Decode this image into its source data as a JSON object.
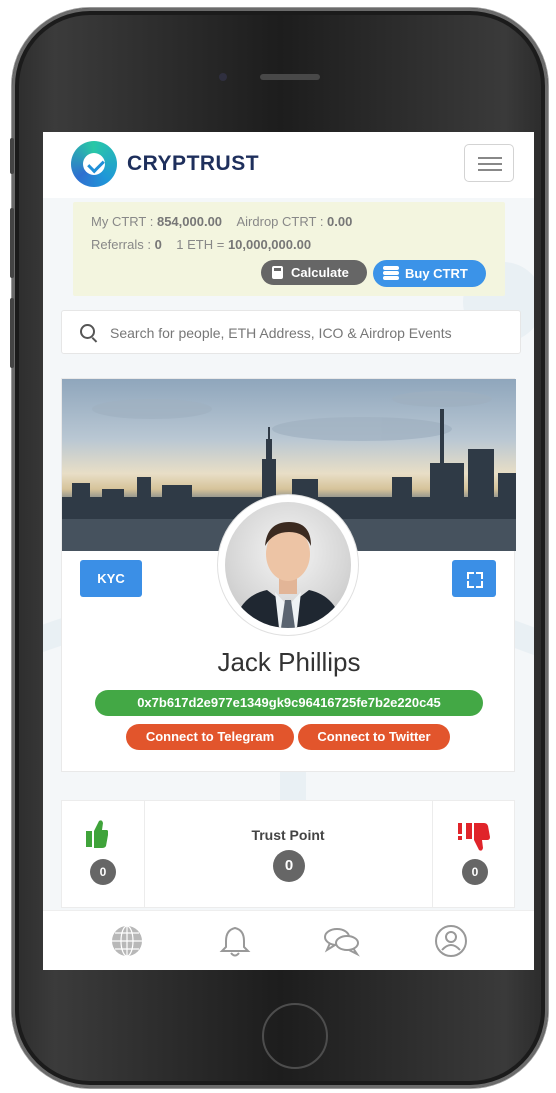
{
  "brand": {
    "name": "CRYPTRUST",
    "logo_icon": "cryptrust-logo-icon"
  },
  "header": {
    "menu_icon": "hamburger-menu-icon"
  },
  "stats": {
    "my_ctrt_label": "My CTRT : ",
    "my_ctrt_value": "854,000.00",
    "airdrop_label": "Airdrop CTRT : ",
    "airdrop_value": "0.00",
    "referrals_label": "Referrals : ",
    "referrals_value": "0",
    "eth_rate_label": "1 ETH = ",
    "eth_rate_value": "10,000,000.00",
    "calculate_label": "Calculate",
    "buy_label": "Buy CTRT"
  },
  "search": {
    "placeholder": "Search for people, ETH Address, ICO & Airdrop Events"
  },
  "profile": {
    "kyc_label": "KYC",
    "name": "Jack Phillips",
    "eth_address": "0x7b617d2e977e1349gk9c96416725fe7b2e220c45",
    "telegram_label": "Connect to Telegram",
    "twitter_label": "Connect to Twitter"
  },
  "trust": {
    "upvotes": "0",
    "title": "Trust Point",
    "score": "0",
    "downvotes": "0"
  },
  "nav": {
    "items": [
      {
        "icon": "globe-icon"
      },
      {
        "icon": "bell-icon"
      },
      {
        "icon": "chat-icon"
      },
      {
        "icon": "user-profile-icon"
      }
    ]
  },
  "colors": {
    "primary": "#3b8fe6",
    "success": "#43a845",
    "danger": "#e2552c",
    "brand_text": "#1e2f5c",
    "stats_bg": "#f3f5df"
  }
}
